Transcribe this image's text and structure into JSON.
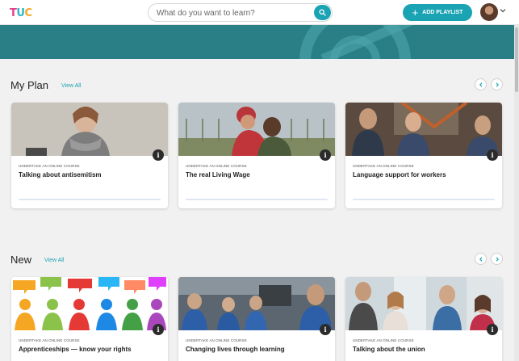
{
  "header": {
    "logo_part1": "T",
    "logo_part2": "U",
    "logo_part3": "C",
    "search_placeholder": "What do you want to learn?",
    "add_playlist_label": "ADD PLAYLIST"
  },
  "sections": [
    {
      "title": "My Plan",
      "view_all_label": "View All",
      "cards": [
        {
          "kicker": "UNDERTAKE AN ONLINE COURSE",
          "title": "Talking about antisemitism",
          "progress": 0
        },
        {
          "kicker": "UNDERTAKE AN ONLINE COURSE",
          "title": "The real Living Wage",
          "progress": 0
        },
        {
          "kicker": "UNDERTAKE AN ONLINE COURSE",
          "title": "Language support for workers",
          "progress": 0
        }
      ]
    },
    {
      "title": "New",
      "view_all_label": "View All",
      "cards": [
        {
          "kicker": "UNDERTAKE AN ONLINE COURSE",
          "title": "Apprenticeships — know your rights"
        },
        {
          "kicker": "UNDERTAKE AN ONLINE COURSE",
          "title": "Changing lives through learning"
        },
        {
          "kicker": "UNDERTAKE AN ONLINE COURSE",
          "title": "Talking about the union"
        }
      ]
    }
  ],
  "colors": {
    "accent": "#1aa3b2",
    "hero": "#2a7f86",
    "background": "#f1f1f1"
  },
  "icons": [
    "search-icon",
    "plus-icon",
    "chevron-down-icon",
    "chevron-left-icon",
    "chevron-right-icon",
    "info-icon"
  ]
}
